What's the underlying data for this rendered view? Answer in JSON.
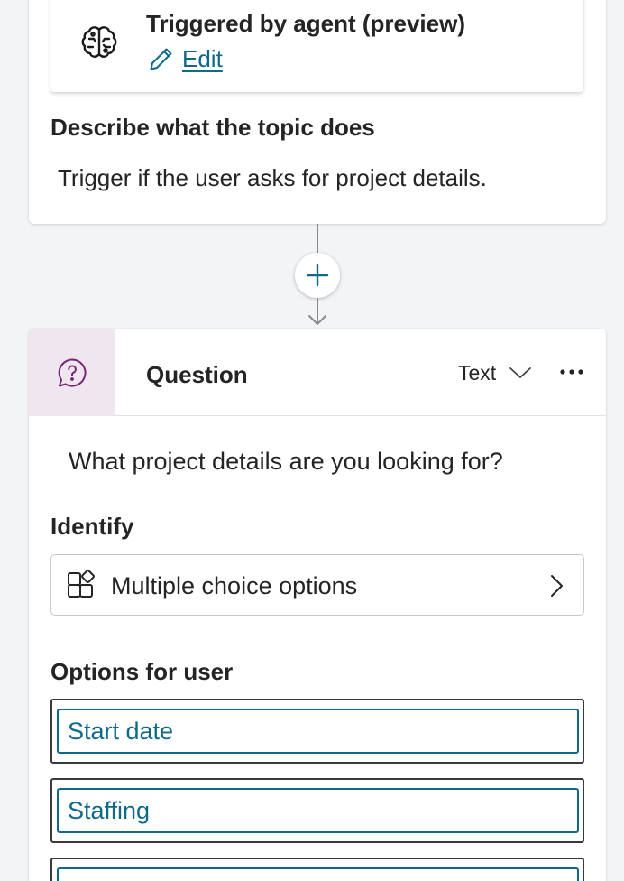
{
  "trigger": {
    "title": "Triggered by agent (preview)",
    "edit_label": "Edit",
    "icon": "brain-icon",
    "describe_label": "Describe what the topic does",
    "describe_text": "Trigger if the user asks for project details."
  },
  "connector": {
    "add_icon": "plus-icon",
    "arrow_icon": "arrow-down-icon"
  },
  "question": {
    "icon": "question-bubble-icon",
    "title": "Question",
    "type_label": "Text",
    "more_icon": "more-horizontal-icon",
    "prompt": "What project details are you looking for?",
    "identify_label": "Identify",
    "identify_value": "Multiple choice options",
    "options_label": "Options for user",
    "options": [
      {
        "value": "Start date"
      },
      {
        "value": "Staffing"
      },
      {
        "value": ""
      }
    ]
  },
  "colors": {
    "accent": "#0f6a8a",
    "question_icon_bg": "#efe6ef",
    "question_icon": "#742774",
    "canvas_bg": "#f3f4f6"
  }
}
